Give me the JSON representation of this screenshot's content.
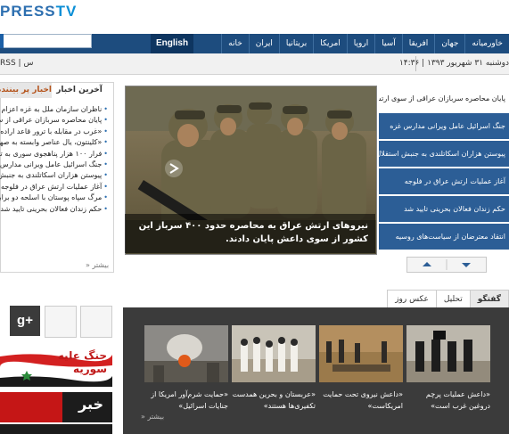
{
  "header": {
    "logo_press": "PRESS",
    "logo_tv": "TV"
  },
  "nav": {
    "items": [
      "خانه",
      "ایران",
      "بریتانیا",
      "امریکا",
      "اروپا",
      "آسیا",
      "افریقا",
      "جهان",
      "خاورمیانه"
    ],
    "english_label": "English"
  },
  "datebar": {
    "date": "دوشنبه ۳۱ شهریور ۱۳۹۳ | ۱۴:۳۶",
    "rss": "RSS | س"
  },
  "news_panel": {
    "tab_latest": "آخرین اخبار",
    "tab_more": "اخبار پر بیننده",
    "items": [
      "ناظران سازمان ملل به غزه اعزام می‌شوند",
      "پایان محاصره سربازان عراقی از سوی ارتش",
      "«غرب در مقابله با ترور قاعد اراده واقعی",
      "«کلینتون، یال عناصر وابسته به صهیونیست",
      "فرار ۱۰۰ هزار پناهجوی سوری به ترکیه",
      "جنگ اسرائیل عامل ویرانی مدارس غزه",
      "پیوستن هزاران اسکاتلندی به جنبش استقلال",
      "آغاز عملیات ارتش عراق در فلوجه",
      "مرگ سپاه پوستان با اسلحه دو برابر سه",
      "حکم زندان فعالان بحرینی تایید شد"
    ],
    "more_label": "» بیشتر"
  },
  "feature": {
    "caption": "نیروهای ارتش عراق به محاصره حدود ۴۰۰ سرباز این کشور از سوی داعش پایان دادند."
  },
  "headlines": [
    "پایان محاصره سربازان عراقی از سوی ارتش",
    "جنگ اسرائیل عامل ویرانی مدارس غزه",
    "پیوستن هزاران اسکاتلندی به جنبش استقلال",
    "آغاز عملیات ارتش عراق در فلوجه",
    "حکم زندان فعالان بحرینی تایید شد",
    "انتقاد معترضان از سیاست‌های روسیه"
  ],
  "bottom_tabs": [
    "گفتگو",
    "تحلیل",
    "عکس روز"
  ],
  "gallery": {
    "captions": [
      "«داعش عملیات پرچم دروغین غرب است»",
      "«داعش نیروی تحت حمایت امریکاست»",
      "«عربستان و بحرین همدست تکفیری‌ها هستند»",
      "«حمایت شرم‌آور امریکا از جنایات اسرائیل»"
    ],
    "more_label": "» بیشتر"
  },
  "social": {
    "gplus_label": "g+"
  },
  "banners": {
    "syria_line1": "جنگ علیه",
    "syria_line2": "سوریه",
    "khabar_text": "خبر"
  },
  "colors": {
    "nav_bg": "#1d4c7e",
    "headline_bg": "#2c5e96",
    "accent": "#2d6fb0"
  }
}
